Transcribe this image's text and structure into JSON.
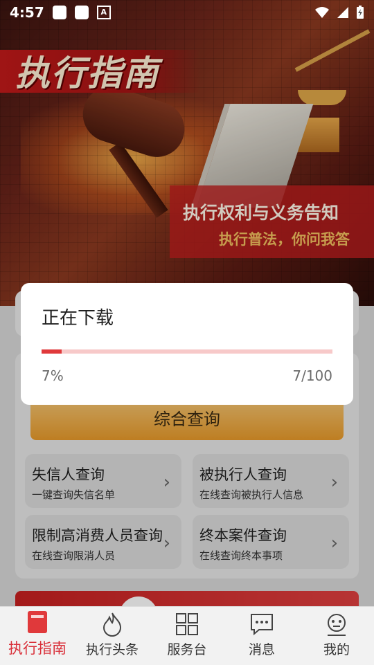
{
  "status_bar": {
    "time": "4:57"
  },
  "banner": {
    "title": "执行指南",
    "subtitle_line1": "执行权利与义务告知",
    "subtitle_line2": "执行普法，你问我答"
  },
  "dialog": {
    "title": "正在下载",
    "progress_fraction": 0.07,
    "progress_percent_label": "7%",
    "progress_count_label": "7/100"
  },
  "main": {
    "query_button_label": "综合查询",
    "cards": [
      {
        "title": "失信人查询",
        "subtitle": "一键查询失信名单"
      },
      {
        "title": "被执行人查询",
        "subtitle": "在线查询被执行人信息"
      },
      {
        "title": "限制高消费人员查询",
        "subtitle": "在线查询限消人员"
      },
      {
        "title": "终本案件查询",
        "subtitle": "在线查询终本事项"
      }
    ]
  },
  "tabbar": {
    "items": [
      {
        "label": "执行指南",
        "icon": "guide-book-icon",
        "active": true
      },
      {
        "label": "执行头条",
        "icon": "flame-icon",
        "active": false
      },
      {
        "label": "服务台",
        "icon": "grid-icon",
        "active": false
      },
      {
        "label": "消息",
        "icon": "chat-bubble-icon",
        "active": false
      },
      {
        "label": "我的",
        "icon": "profile-face-icon",
        "active": false
      }
    ]
  },
  "colors": {
    "accent": "#d9303a",
    "progress": "#e0393b",
    "progress_track": "#f7c9c9"
  }
}
